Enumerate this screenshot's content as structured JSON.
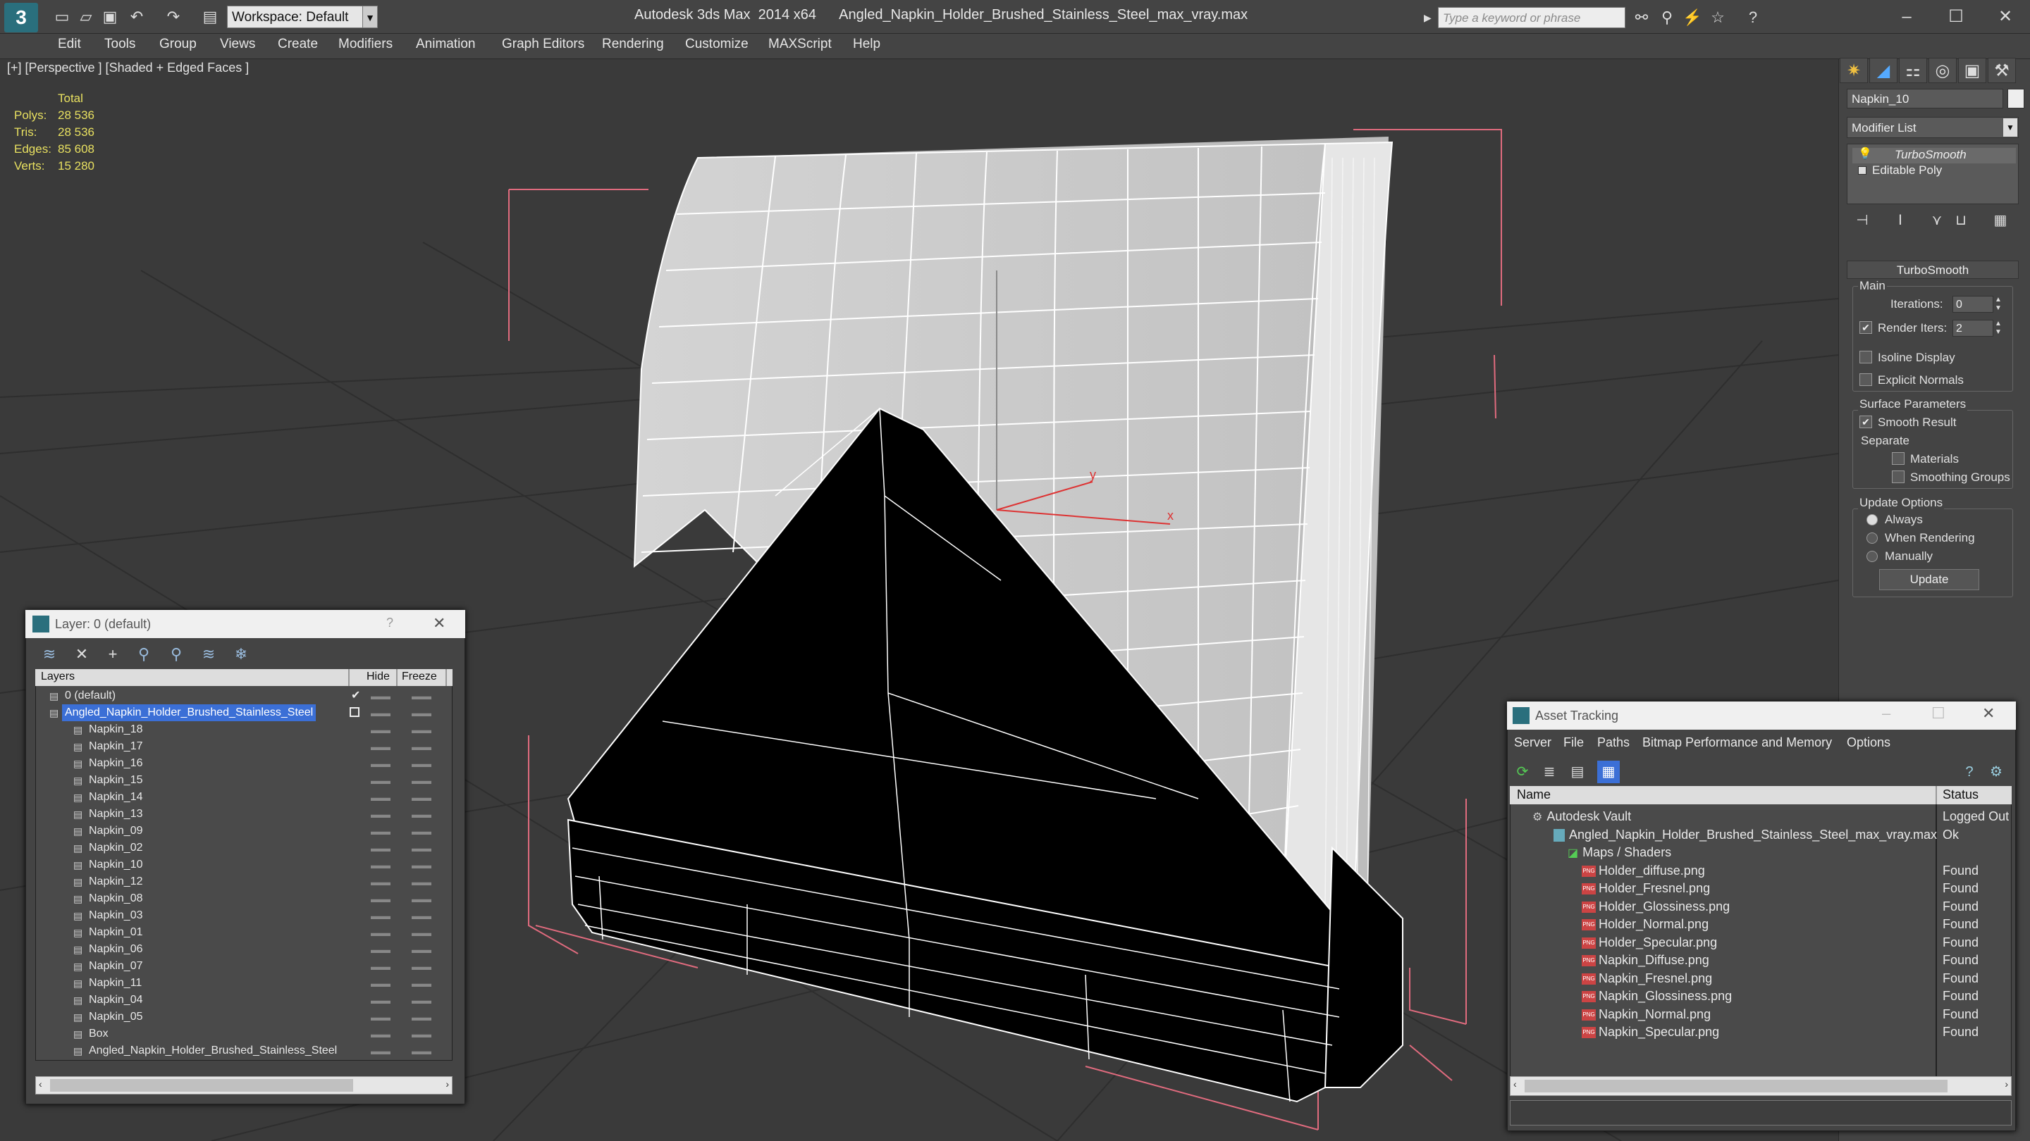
{
  "app": {
    "title": "Autodesk 3ds Max  2014 x64      Angled_Napkin_Holder_Brushed_Stainless_Steel_max_vray.max",
    "logo": "3",
    "workspace": "Workspace: Default",
    "search_placeholder": "Type a keyword or phrase",
    "win_minimize": "–",
    "win_maximize": "☐",
    "win_close": "✕"
  },
  "menu": [
    "Edit",
    "Tools",
    "Group",
    "Views",
    "Create",
    "Modifiers",
    "Animation",
    "Graph Editors",
    "Rendering",
    "Customize",
    "MAXScript",
    "Help"
  ],
  "viewport": {
    "label": "[+] [Perspective ] [Shaded + Edged Faces ]",
    "stats_header": "Total",
    "stats": [
      {
        "label": "Polys:",
        "value": "28 536"
      },
      {
        "label": "Tris:",
        "value": "28 536"
      },
      {
        "label": "Edges:",
        "value": "85 608"
      },
      {
        "label": "Verts:",
        "value": "15 280"
      }
    ],
    "axis_x": "x",
    "axis_y": "y"
  },
  "command_panel": {
    "object_name": "Napkin_10",
    "modifier_list": "Modifier List",
    "stack": [
      "TurboSmooth",
      "Editable Poly"
    ],
    "rollout_title": "TurboSmooth",
    "main_label": "Main",
    "iterations_label": "Iterations:",
    "iterations_value": "0",
    "render_iters_label": "Render Iters:",
    "render_iters_value": "2",
    "isoline_label": "Isoline Display",
    "explicit_label": "Explicit Normals",
    "surface_label": "Surface Parameters",
    "smooth_label": "Smooth Result",
    "separate_label": "Separate",
    "materials_label": "Materials",
    "smoothing_label": "Smoothing Groups",
    "update_options_label": "Update Options",
    "always_label": "Always",
    "when_rendering_label": "When Rendering",
    "manually_label": "Manually",
    "update_button": "Update",
    "check": "✔"
  },
  "layer_window": {
    "title": "Layer: 0 (default)",
    "help": "?",
    "close": "✕",
    "col_layers": "Layers",
    "col_hide": "Hide",
    "col_freeze": "Freeze",
    "rows": [
      "0 (default)",
      "Angled_Napkin_Holder_Brushed_Stainless_Steel",
      "Napkin_18",
      "Napkin_17",
      "Napkin_16",
      "Napkin_15",
      "Napkin_14",
      "Napkin_13",
      "Napkin_09",
      "Napkin_02",
      "Napkin_10",
      "Napkin_12",
      "Napkin_08",
      "Napkin_03",
      "Napkin_01",
      "Napkin_06",
      "Napkin_07",
      "Napkin_11",
      "Napkin_04",
      "Napkin_05",
      "Box",
      "Angled_Napkin_Holder_Brushed_Stainless_Steel"
    ],
    "dash": "▬▬",
    "check": "✔"
  },
  "asset_tracking": {
    "title": "Asset Tracking",
    "menu": [
      "Server",
      "File",
      "Paths",
      "Bitmap Performance and Memory",
      "Options"
    ],
    "col_name": "Name",
    "col_status": "Status",
    "rows": [
      {
        "name": "Autodesk Vault",
        "status": "Logged Out"
      },
      {
        "name": "Angled_Napkin_Holder_Brushed_Stainless_Steel_max_vray.max",
        "status": "Ok"
      },
      {
        "name": "Maps / Shaders",
        "status": ""
      },
      {
        "name": "Holder_diffuse.png",
        "status": "Found"
      },
      {
        "name": "Holder_Fresnel.png",
        "status": "Found"
      },
      {
        "name": "Holder_Glossiness.png",
        "status": "Found"
      },
      {
        "name": "Holder_Normal.png",
        "status": "Found"
      },
      {
        "name": "Holder_Specular.png",
        "status": "Found"
      },
      {
        "name": "Napkin_Diffuse.png",
        "status": "Found"
      },
      {
        "name": "Napkin_Fresnel.png",
        "status": "Found"
      },
      {
        "name": "Napkin_Glossiness.png",
        "status": "Found"
      },
      {
        "name": "Napkin_Normal.png",
        "status": "Found"
      },
      {
        "name": "Napkin_Specular.png",
        "status": "Found"
      }
    ],
    "png_badge": "PNG",
    "minimize": "–",
    "maximize": "☐",
    "close": "✕"
  }
}
